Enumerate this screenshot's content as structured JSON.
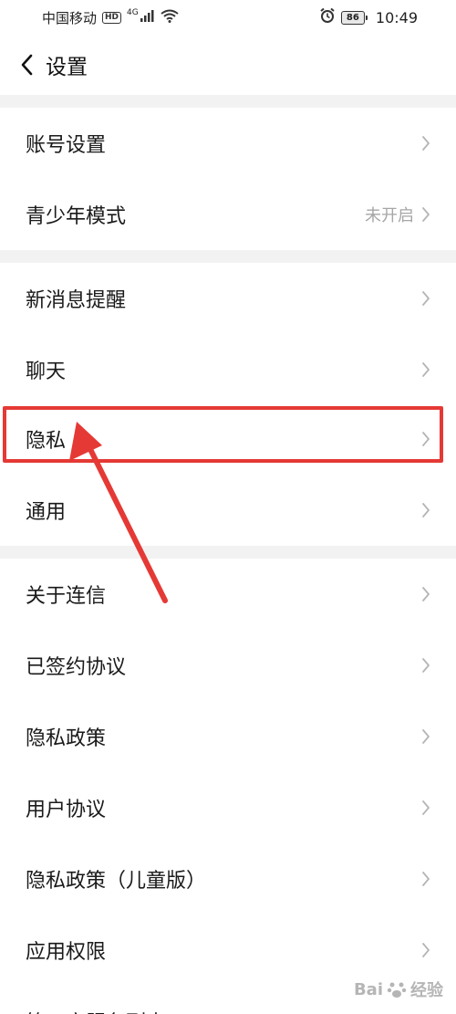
{
  "status_bar": {
    "carrier": "中国移动",
    "hd": "HD",
    "network": "4G",
    "battery": "86",
    "time": "10:49",
    "icons": [
      "hd-badge",
      "signal-icon",
      "wifi-icon",
      "alarm-icon",
      "battery-icon"
    ]
  },
  "nav": {
    "title": "设置",
    "back_icon": "chevron-left-icon"
  },
  "groups": [
    {
      "items": [
        {
          "label": "账号设置",
          "value": ""
        },
        {
          "label": "青少年模式",
          "value": "未开启"
        }
      ]
    },
    {
      "items": [
        {
          "label": "新消息提醒",
          "value": ""
        },
        {
          "label": "聊天",
          "value": ""
        },
        {
          "label": "隐私",
          "value": "",
          "highlighted": true
        },
        {
          "label": "通用",
          "value": ""
        }
      ]
    },
    {
      "items": [
        {
          "label": "关于连信",
          "value": ""
        },
        {
          "label": "已签约协议",
          "value": ""
        },
        {
          "label": "隐私政策",
          "value": ""
        },
        {
          "label": "用户协议",
          "value": ""
        },
        {
          "label": "隐私政策（儿童版）",
          "value": ""
        },
        {
          "label": "应用权限",
          "value": ""
        },
        {
          "label": "第三方服务列表",
          "value": ""
        }
      ]
    }
  ],
  "colors": {
    "annotation": "#e53935",
    "separator": "#f2f2f2",
    "secondary_text": "#a6a6a6"
  },
  "watermark": {
    "brand": "Bai",
    "suffix": "经验",
    "url": "jingyan.baidu.com"
  }
}
